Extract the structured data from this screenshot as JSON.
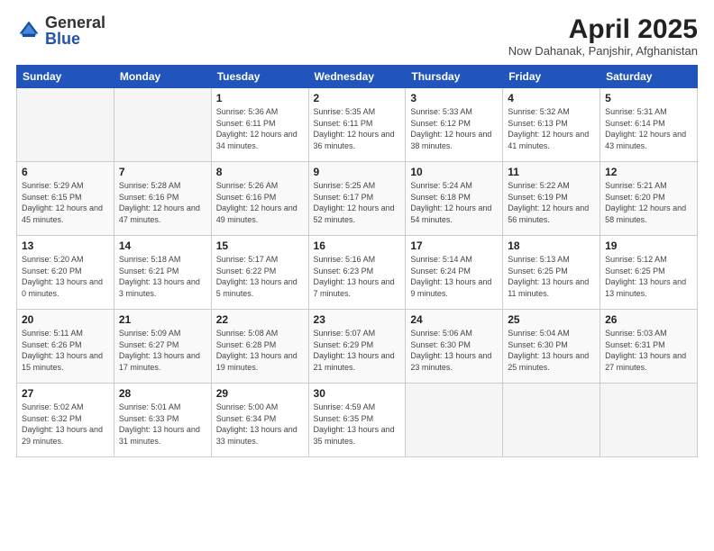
{
  "header": {
    "logo_general": "General",
    "logo_blue": "Blue",
    "month_title": "April 2025",
    "location": "Now Dahanak, Panjshir, Afghanistan"
  },
  "days_of_week": [
    "Sunday",
    "Monday",
    "Tuesday",
    "Wednesday",
    "Thursday",
    "Friday",
    "Saturday"
  ],
  "weeks": [
    [
      {
        "day": "",
        "info": ""
      },
      {
        "day": "",
        "info": ""
      },
      {
        "day": "1",
        "info": "Sunrise: 5:36 AM\nSunset: 6:11 PM\nDaylight: 12 hours and 34 minutes."
      },
      {
        "day": "2",
        "info": "Sunrise: 5:35 AM\nSunset: 6:11 PM\nDaylight: 12 hours and 36 minutes."
      },
      {
        "day": "3",
        "info": "Sunrise: 5:33 AM\nSunset: 6:12 PM\nDaylight: 12 hours and 38 minutes."
      },
      {
        "day": "4",
        "info": "Sunrise: 5:32 AM\nSunset: 6:13 PM\nDaylight: 12 hours and 41 minutes."
      },
      {
        "day": "5",
        "info": "Sunrise: 5:31 AM\nSunset: 6:14 PM\nDaylight: 12 hours and 43 minutes."
      }
    ],
    [
      {
        "day": "6",
        "info": "Sunrise: 5:29 AM\nSunset: 6:15 PM\nDaylight: 12 hours and 45 minutes."
      },
      {
        "day": "7",
        "info": "Sunrise: 5:28 AM\nSunset: 6:16 PM\nDaylight: 12 hours and 47 minutes."
      },
      {
        "day": "8",
        "info": "Sunrise: 5:26 AM\nSunset: 6:16 PM\nDaylight: 12 hours and 49 minutes."
      },
      {
        "day": "9",
        "info": "Sunrise: 5:25 AM\nSunset: 6:17 PM\nDaylight: 12 hours and 52 minutes."
      },
      {
        "day": "10",
        "info": "Sunrise: 5:24 AM\nSunset: 6:18 PM\nDaylight: 12 hours and 54 minutes."
      },
      {
        "day": "11",
        "info": "Sunrise: 5:22 AM\nSunset: 6:19 PM\nDaylight: 12 hours and 56 minutes."
      },
      {
        "day": "12",
        "info": "Sunrise: 5:21 AM\nSunset: 6:20 PM\nDaylight: 12 hours and 58 minutes."
      }
    ],
    [
      {
        "day": "13",
        "info": "Sunrise: 5:20 AM\nSunset: 6:20 PM\nDaylight: 13 hours and 0 minutes."
      },
      {
        "day": "14",
        "info": "Sunrise: 5:18 AM\nSunset: 6:21 PM\nDaylight: 13 hours and 3 minutes."
      },
      {
        "day": "15",
        "info": "Sunrise: 5:17 AM\nSunset: 6:22 PM\nDaylight: 13 hours and 5 minutes."
      },
      {
        "day": "16",
        "info": "Sunrise: 5:16 AM\nSunset: 6:23 PM\nDaylight: 13 hours and 7 minutes."
      },
      {
        "day": "17",
        "info": "Sunrise: 5:14 AM\nSunset: 6:24 PM\nDaylight: 13 hours and 9 minutes."
      },
      {
        "day": "18",
        "info": "Sunrise: 5:13 AM\nSunset: 6:25 PM\nDaylight: 13 hours and 11 minutes."
      },
      {
        "day": "19",
        "info": "Sunrise: 5:12 AM\nSunset: 6:25 PM\nDaylight: 13 hours and 13 minutes."
      }
    ],
    [
      {
        "day": "20",
        "info": "Sunrise: 5:11 AM\nSunset: 6:26 PM\nDaylight: 13 hours and 15 minutes."
      },
      {
        "day": "21",
        "info": "Sunrise: 5:09 AM\nSunset: 6:27 PM\nDaylight: 13 hours and 17 minutes."
      },
      {
        "day": "22",
        "info": "Sunrise: 5:08 AM\nSunset: 6:28 PM\nDaylight: 13 hours and 19 minutes."
      },
      {
        "day": "23",
        "info": "Sunrise: 5:07 AM\nSunset: 6:29 PM\nDaylight: 13 hours and 21 minutes."
      },
      {
        "day": "24",
        "info": "Sunrise: 5:06 AM\nSunset: 6:30 PM\nDaylight: 13 hours and 23 minutes."
      },
      {
        "day": "25",
        "info": "Sunrise: 5:04 AM\nSunset: 6:30 PM\nDaylight: 13 hours and 25 minutes."
      },
      {
        "day": "26",
        "info": "Sunrise: 5:03 AM\nSunset: 6:31 PM\nDaylight: 13 hours and 27 minutes."
      }
    ],
    [
      {
        "day": "27",
        "info": "Sunrise: 5:02 AM\nSunset: 6:32 PM\nDaylight: 13 hours and 29 minutes."
      },
      {
        "day": "28",
        "info": "Sunrise: 5:01 AM\nSunset: 6:33 PM\nDaylight: 13 hours and 31 minutes."
      },
      {
        "day": "29",
        "info": "Sunrise: 5:00 AM\nSunset: 6:34 PM\nDaylight: 13 hours and 33 minutes."
      },
      {
        "day": "30",
        "info": "Sunrise: 4:59 AM\nSunset: 6:35 PM\nDaylight: 13 hours and 35 minutes."
      },
      {
        "day": "",
        "info": ""
      },
      {
        "day": "",
        "info": ""
      },
      {
        "day": "",
        "info": ""
      }
    ]
  ]
}
